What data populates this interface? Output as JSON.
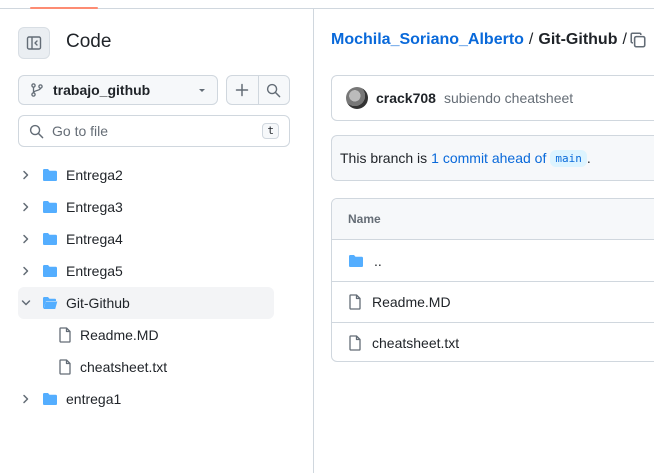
{
  "sidebar": {
    "title": "Code",
    "branch": "trabajo_github",
    "goto_placeholder": "Go to file",
    "goto_shortcut": "t",
    "tree": [
      {
        "label": "Entrega2",
        "type": "folder",
        "expanded": false
      },
      {
        "label": "Entrega3",
        "type": "folder",
        "expanded": false
      },
      {
        "label": "Entrega4",
        "type": "folder",
        "expanded": false
      },
      {
        "label": "Entrega5",
        "type": "folder",
        "expanded": false
      },
      {
        "label": "Git-Github",
        "type": "folder",
        "expanded": true,
        "selected": true
      },
      {
        "label": "Readme.MD",
        "type": "file",
        "child": true
      },
      {
        "label": "cheatsheet.txt",
        "type": "file",
        "child": true
      },
      {
        "label": "entrega1",
        "type": "folder",
        "expanded": false
      }
    ]
  },
  "main": {
    "breadcrumb": {
      "repo": "Mochila_Soriano_Alberto",
      "separator": "/",
      "current": "Git-Github",
      "trailing_separator": "/"
    },
    "commit": {
      "author": "crack708",
      "message": "subiendo cheatsheet"
    },
    "ahead": {
      "prefix": "This branch is",
      "link": "1 commit ahead of",
      "branch": "main",
      "suffix": "."
    },
    "files": {
      "header": "Name",
      "rows": [
        {
          "name": "..",
          "type": "parent-folder"
        },
        {
          "name": "Readme.MD",
          "type": "file"
        },
        {
          "name": "cheatsheet.txt",
          "type": "file"
        }
      ]
    }
  },
  "colors": {
    "accent": "#0969da",
    "folder": "#54aeff",
    "border": "#d0d7de",
    "muted": "#656d76",
    "top_underline": "#fd8c73"
  }
}
